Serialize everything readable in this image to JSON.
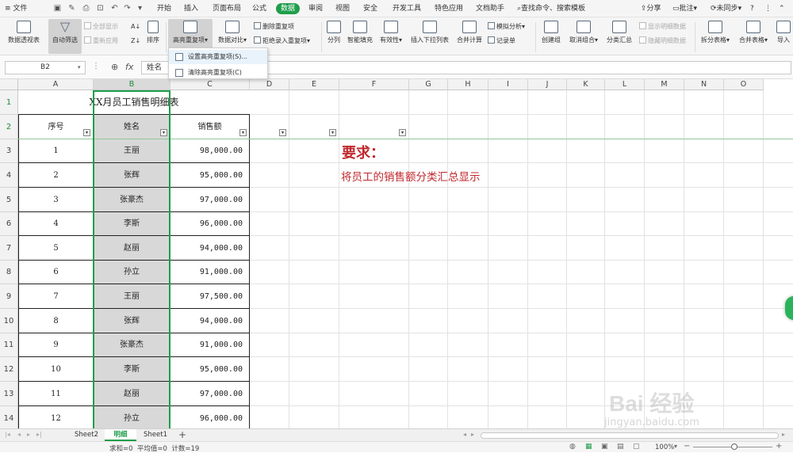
{
  "menubar": {
    "file": "文件",
    "tabs": [
      "开始",
      "插入",
      "页面布局",
      "公式",
      "数据",
      "审阅",
      "视图",
      "安全",
      "开发工具",
      "特色应用",
      "文档助手"
    ],
    "active_tab": "数据",
    "search": "查找命令、搜索模板",
    "share": "分享",
    "comment": "批注",
    "sync": "未同步"
  },
  "ribbon": {
    "pivot": "数据透视表",
    "autofilter": "自动筛选",
    "show_all": "全部显示",
    "reapply": "重新应用",
    "sort": "排序",
    "highlight_dup": "高亮重复项",
    "compare": "数据对比",
    "delete_dup": "删除重复项",
    "reject_dup": "拒绝录入重复项",
    "split": "分列",
    "smart_fill": "智能填充",
    "validity": "有效性",
    "dropdown_list": "插入下拉列表",
    "merge_calc": "合并计算",
    "simulate": "模拟分析",
    "record": "记录单",
    "create_group": "创建组",
    "ungroup": "取消组合",
    "subtotal": "分类汇总",
    "show_detail": "显示明细数据",
    "hide_detail": "隐藏明细数据",
    "split_table": "拆分表格",
    "merge_table": "合并表格",
    "import": "导入"
  },
  "dropdown_menu": {
    "items": [
      "设置高亮重复项(S)...",
      "清除高亮重复项(C)"
    ]
  },
  "formula_bar": {
    "name_box": "B2",
    "fx_label": "fx",
    "content": "姓名"
  },
  "columns": [
    "A",
    "B",
    "C",
    "D",
    "E",
    "F",
    "G",
    "H",
    "I",
    "J",
    "K",
    "L",
    "M",
    "N",
    "O"
  ],
  "rows": [
    "1",
    "2",
    "3",
    "4",
    "5",
    "6",
    "7",
    "8",
    "9",
    "10",
    "11",
    "12",
    "13",
    "14"
  ],
  "sheet": {
    "title": "XX月员工销售明细表",
    "headers": [
      "序号",
      "姓名",
      "销售额"
    ],
    "records": [
      [
        "1",
        "王丽",
        "98,000.00"
      ],
      [
        "2",
        "张辉",
        "95,000.00"
      ],
      [
        "3",
        "张豪杰",
        "97,000.00"
      ],
      [
        "4",
        "李斯",
        "96,000.00"
      ],
      [
        "5",
        "赵丽",
        "94,000.00"
      ],
      [
        "6",
        "孙立",
        "91,000.00"
      ],
      [
        "7",
        "王丽",
        "97,500.00"
      ],
      [
        "8",
        "张辉",
        "94,000.00"
      ],
      [
        "9",
        "张豪杰",
        "91,000.00"
      ],
      [
        "10",
        "李斯",
        "95,000.00"
      ],
      [
        "11",
        "赵丽",
        "97,000.00"
      ],
      [
        "12",
        "孙立",
        "96,000.00"
      ]
    ],
    "note_title": "要求：",
    "note_body": "将员工的销售额分类汇总显示",
    "note_color": "#c0282d"
  },
  "sheet_tabs": [
    "Sheet2",
    "明细",
    "Sheet1"
  ],
  "active_sheet": "明细",
  "status": {
    "summary": "求和=0  平均值=0  计数=19",
    "zoom": "100%"
  },
  "watermark": {
    "logo": "Bai 经验",
    "url": "jingyan.baidu.com"
  },
  "colors": {
    "accent": "#1e9e4a",
    "selection": "#1e8a3a"
  }
}
